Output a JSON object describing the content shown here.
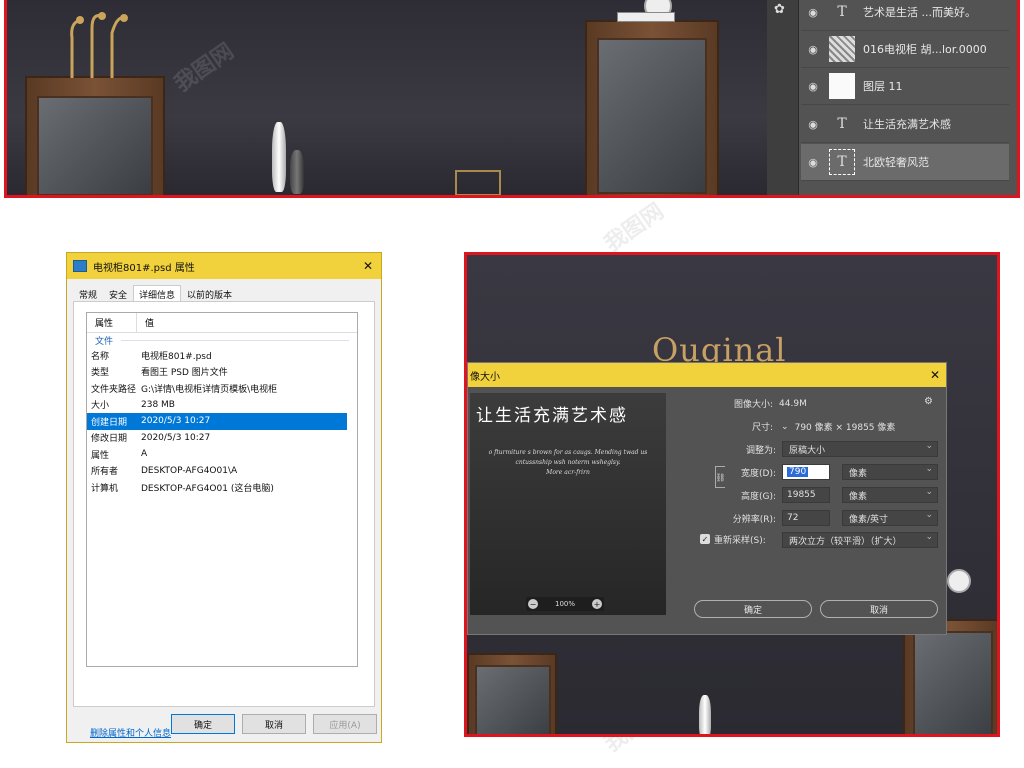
{
  "layers_panel": {
    "rows": [
      {
        "name": "艺术是生活 ...而美好。",
        "kind": "text"
      },
      {
        "name": "016电视柜 胡...lor.0000",
        "kind": "image"
      },
      {
        "name": "图层 11",
        "kind": "white"
      },
      {
        "name": "让生活充满艺术感",
        "kind": "text"
      },
      {
        "name": "北欧轻奢风范",
        "kind": "text",
        "selected": true
      }
    ],
    "text_glyph": "T",
    "eye_icon": "eye-icon",
    "tool_icon": "palette-icon"
  },
  "properties_dialog": {
    "title": "电视柜801#.psd 属性",
    "close": "✕",
    "tabs": [
      "常规",
      "安全",
      "详细信息",
      "以前的版本"
    ],
    "active_tab": "详细信息",
    "col_property": "属性",
    "col_value": "值",
    "section_file": "文件",
    "rows": [
      {
        "k": "名称",
        "v": "电视柜801#.psd"
      },
      {
        "k": "类型",
        "v": "看图王 PSD 图片文件"
      },
      {
        "k": "文件夹路径",
        "v": "G:\\详情\\电视柜详情页模板\\电视柜"
      },
      {
        "k": "大小",
        "v": "238 MB"
      },
      {
        "k": "创建日期",
        "v": "2020/5/3 10:27",
        "selected": true
      },
      {
        "k": "修改日期",
        "v": "2020/5/3 10:27"
      },
      {
        "k": "属性",
        "v": "A"
      },
      {
        "k": "所有者",
        "v": "DESKTOP-AFG4O01\\A"
      },
      {
        "k": "计算机",
        "v": "DESKTOP-AFG4O01 (这台电脑)"
      }
    ],
    "remove_link": "删除属性和个人信息",
    "ok": "确定",
    "cancel": "取消",
    "apply": "应用(A)"
  },
  "image_size_dialog": {
    "background_brand": "Ouginal",
    "title": "像大小",
    "close": "✕",
    "preview_title": "让生活充满艺术感",
    "preview_lines": [
      "o fturmiture s brown for as caugs. Mending twad us",
      "cntussnship wsh noterm wsheglsy.",
      "More acr-frirn"
    ],
    "zoom": "100%",
    "image_size_label": "图像大小:",
    "image_size_value": "44.9M",
    "dimensions_label": "尺寸:",
    "dimensions_value": "790 像素 × 19855 像素",
    "fit_to_label": "调整为:",
    "fit_to_value": "原稿大小",
    "width_label": "宽度(D):",
    "width_value": "790",
    "width_unit": "像素",
    "height_label": "高度(G):",
    "height_value": "19855",
    "height_unit": "像素",
    "resolution_label": "分辨率(R):",
    "resolution_value": "72",
    "resolution_unit": "像素/英寸",
    "resample_label": "重新采样(S):",
    "resample_value": "两次立方（较平滑）（扩大）",
    "ok": "确定",
    "cancel": "取消"
  },
  "watermark": "我图网"
}
